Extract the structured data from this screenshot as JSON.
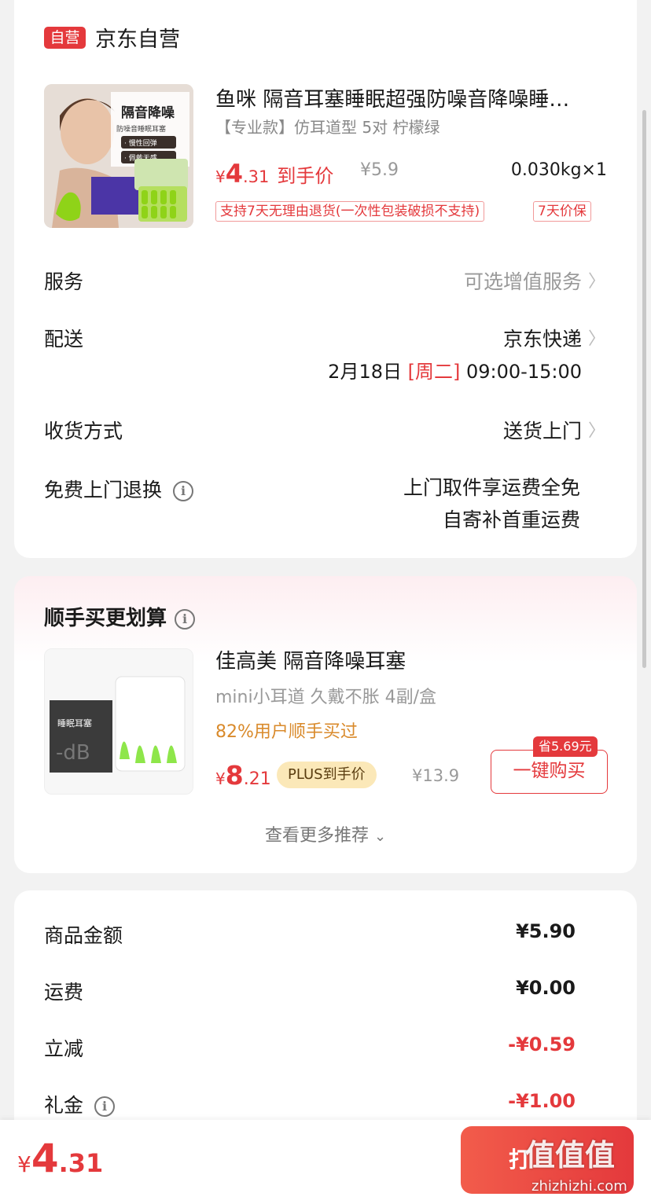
{
  "shop": {
    "badge": "自营",
    "name": "京东自营"
  },
  "product": {
    "title": "鱼咪 隔音耳塞睡眠超强防噪音降噪睡…",
    "spec": "【专业款】仿耳道型 5对 柠檬绿",
    "price": {
      "yen": "¥",
      "int": "4",
      "dec": ".31",
      "tag": "到手价"
    },
    "original_price": "¥5.9",
    "weight_qty": "0.030kg×1",
    "image_texts": [
      "隔音降噪",
      "防噪音睡眠耳塞",
      "· 慢性回弹",
      "· 佩戴无感"
    ],
    "service_tags": [
      "支持7天无理由退货(一次性包装破损不支持)",
      "7天价保"
    ]
  },
  "rows": {
    "service": {
      "label": "服务",
      "value": "可选增值服务"
    },
    "delivery": {
      "label": "配送",
      "value": "京东快递",
      "date": "2月18日",
      "weekday": "[周二]",
      "time": "09:00-15:00"
    },
    "receive": {
      "label": "收货方式",
      "value": "送货上门"
    },
    "free_return": {
      "label": "免费上门退换",
      "line1": "上门取件享运费全免",
      "line2": "自寄补首重运费"
    }
  },
  "recommend": {
    "section_title": "顺手买更划算",
    "title": "佳高美 隔音降噪耳塞",
    "subtitle": "mini小耳道  久戴不胀 4副/盒",
    "buyers": "82%用户顺手买过",
    "price": {
      "yen": "¥",
      "int": "8",
      "dec": ".21"
    },
    "plus_label": "PLUS到手价",
    "original_price": "¥13.9",
    "save_tag": "省5.69元",
    "buy_button": "一键购买",
    "see_more": "查看更多推荐",
    "image_text": "睡眠耳塞"
  },
  "summary": [
    {
      "label": "商品金额",
      "value": "¥5.90",
      "red": false,
      "info": false
    },
    {
      "label": "运费",
      "value": "¥0.00",
      "red": false,
      "info": false
    },
    {
      "label": "立减",
      "value": "-¥0.59",
      "red": true,
      "info": false
    },
    {
      "label": "礼金",
      "value": "-¥1.00",
      "red": true,
      "info": true
    }
  ],
  "bottom": {
    "total": {
      "yen": "¥",
      "int": "4",
      "dec": ".31"
    },
    "pay_button": "打",
    "watermark": "值值值",
    "watermark_url": "zhizhizhi.com"
  },
  "icons": {
    "chevron": "chevron-right-icon",
    "info": "info-circle-icon",
    "expand": "chevron-down-icon"
  },
  "colors": {
    "accent": "#e4393c",
    "gold": "#d98a2b",
    "plus_bg": "#fbe8b8"
  }
}
